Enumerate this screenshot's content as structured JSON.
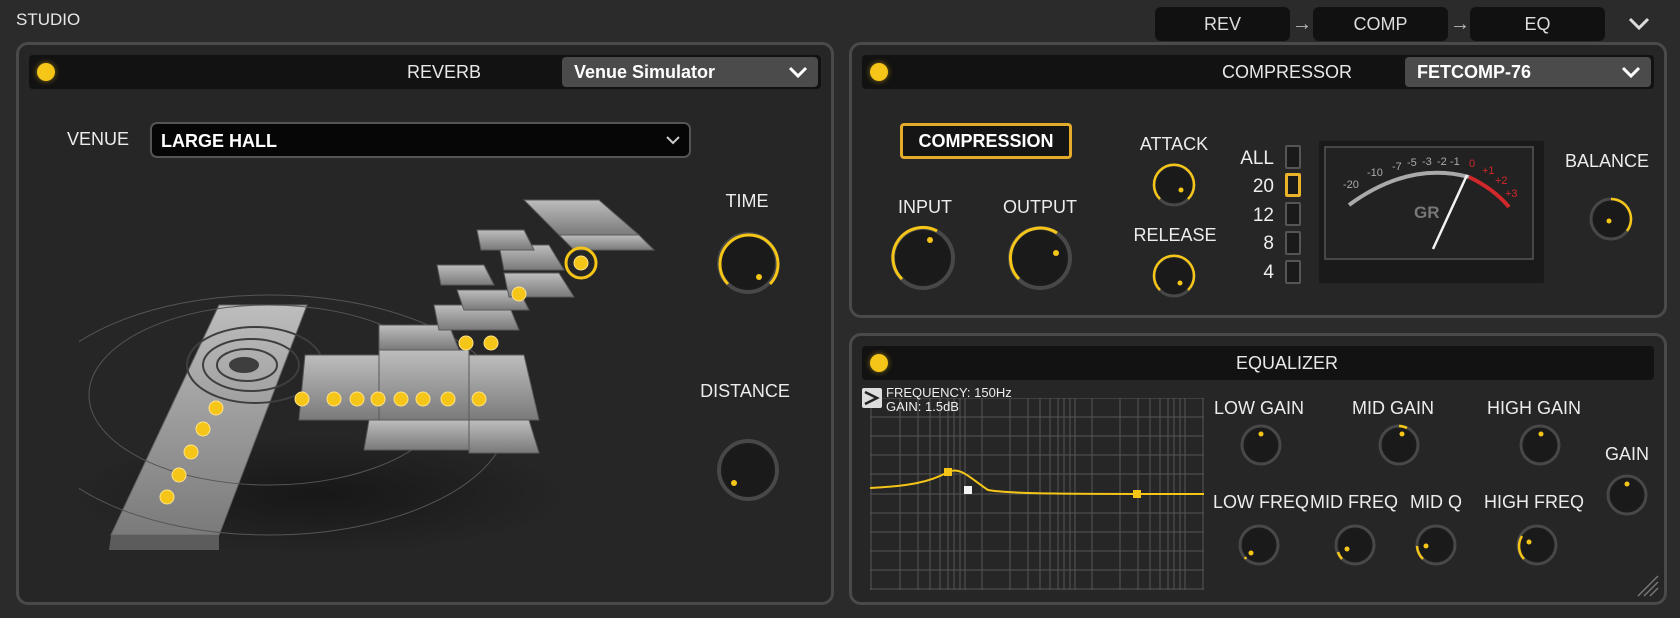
{
  "app": {
    "title": "STUDIO"
  },
  "chain": [
    {
      "label": "REV"
    },
    {
      "label": "COMP"
    },
    {
      "label": "EQ"
    }
  ],
  "chain_arrow": "→",
  "reverb": {
    "title": "REVERB",
    "preset": "Venue Simulator",
    "venue_label": "VENUE",
    "venue_value": "LARGE HALL",
    "time_label": "TIME",
    "distance_label": "DISTANCE"
  },
  "compressor": {
    "title": "COMPRESSOR",
    "preset": "FETCOMP-76",
    "compression_button": "COMPRESSION",
    "input_label": "INPUT",
    "output_label": "OUTPUT",
    "attack_label": "ATTACK",
    "release_label": "RELEASE",
    "balance_label": "BALANCE",
    "ratios": [
      "ALL",
      "20",
      "12",
      "8",
      "4"
    ],
    "selected_ratio": "20",
    "meter": {
      "label": "GR",
      "scale": [
        "-20",
        "-10",
        "-7",
        "-5",
        "-3",
        "-2",
        "-1",
        "0",
        "+1",
        "+2",
        "+3"
      ]
    }
  },
  "equalizer": {
    "title": "EQUALIZER",
    "readout_frequency": "FREQUENCY: 150Hz",
    "readout_gain": "GAIN: 1.5dB",
    "low_gain": "LOW GAIN",
    "mid_gain": "MID GAIN",
    "high_gain": "HIGH GAIN",
    "gain": "GAIN",
    "low_freq": "LOW FREQ",
    "mid_freq": "MID FREQ",
    "mid_q": "MID Q",
    "high_freq": "HIGH FREQ"
  },
  "colors": {
    "accent": "#f5c518",
    "red": "#d0282b",
    "panel": "#262626"
  }
}
